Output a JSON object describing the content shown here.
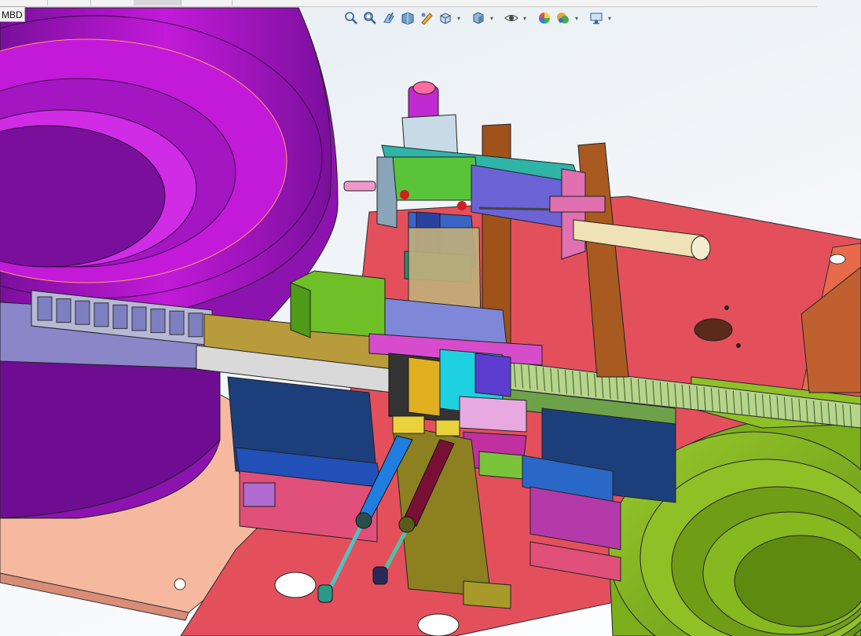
{
  "tabs": {
    "mbd_label": "MBD"
  },
  "heads_up_toolbar": {
    "buttons": [
      {
        "name": "zoom-to-fit-icon"
      },
      {
        "name": "zoom-to-area-icon"
      },
      {
        "name": "previous-view-icon"
      },
      {
        "name": "section-view-icon"
      },
      {
        "name": "dynamic-annotation-icon"
      },
      {
        "name": "view-orientation-icon",
        "dropdown": true
      },
      {
        "name": "display-style-icon",
        "dropdown": true
      },
      {
        "name": "hide-show-items-icon",
        "dropdown": true
      },
      {
        "name": "edit-appearance-icon"
      },
      {
        "name": "apply-scene-icon",
        "dropdown": true
      },
      {
        "name": "view-settings-icon",
        "dropdown": true
      }
    ]
  },
  "colors": {
    "viewport_bg": "#eef2f6",
    "bowl_left": "#b010c8",
    "bowl_right": "#7aab1a",
    "base_plate": "#e0505c",
    "sub_plate": "#f4b096"
  }
}
